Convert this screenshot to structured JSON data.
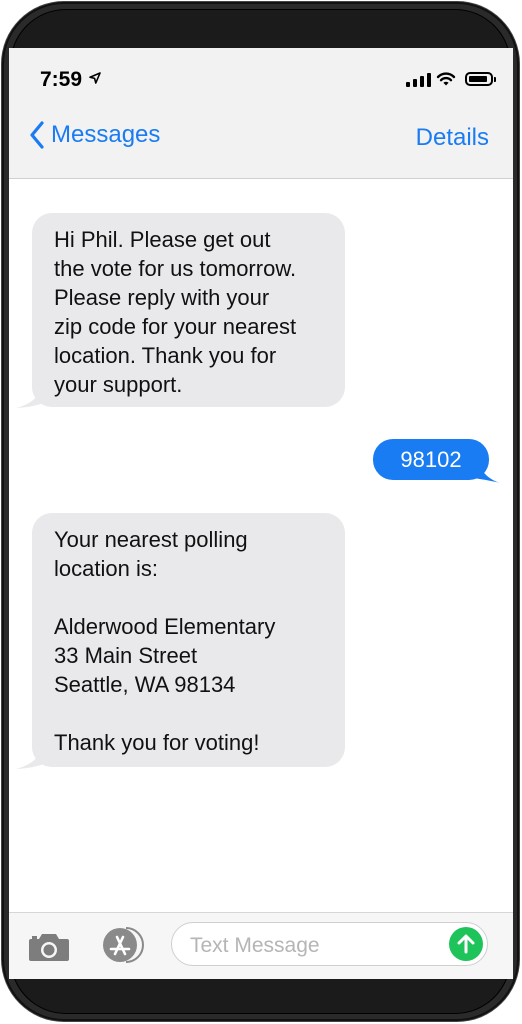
{
  "status_bar": {
    "time": "7:59"
  },
  "nav": {
    "back_label": "Messages",
    "details_label": "Details"
  },
  "messages": [
    {
      "direction": "incoming",
      "text": "Hi Phil. Please get out\nthe vote for us tomorrow.\nPlease reply with your\nzip code for your nearest\nlocation. Thank you for\nyour support."
    },
    {
      "direction": "outgoing",
      "text": "98102"
    },
    {
      "direction": "incoming",
      "text": "Your nearest polling\nlocation is:\n\nAlderwood Elementary\n33 Main Street\nSeattle, WA 98134\n\nThank you for voting!"
    }
  ],
  "composer": {
    "placeholder": "Text Message"
  },
  "colors": {
    "accent": "#1a7cf2",
    "incoming_bubble": "#e9e9eb",
    "send": "#1ec35a"
  },
  "icons": [
    "location-arrow-icon",
    "signal-icon",
    "wifi-icon",
    "battery-icon",
    "chevron-left-icon",
    "camera-icon",
    "app-store-icon",
    "send-arrow-icon"
  ]
}
